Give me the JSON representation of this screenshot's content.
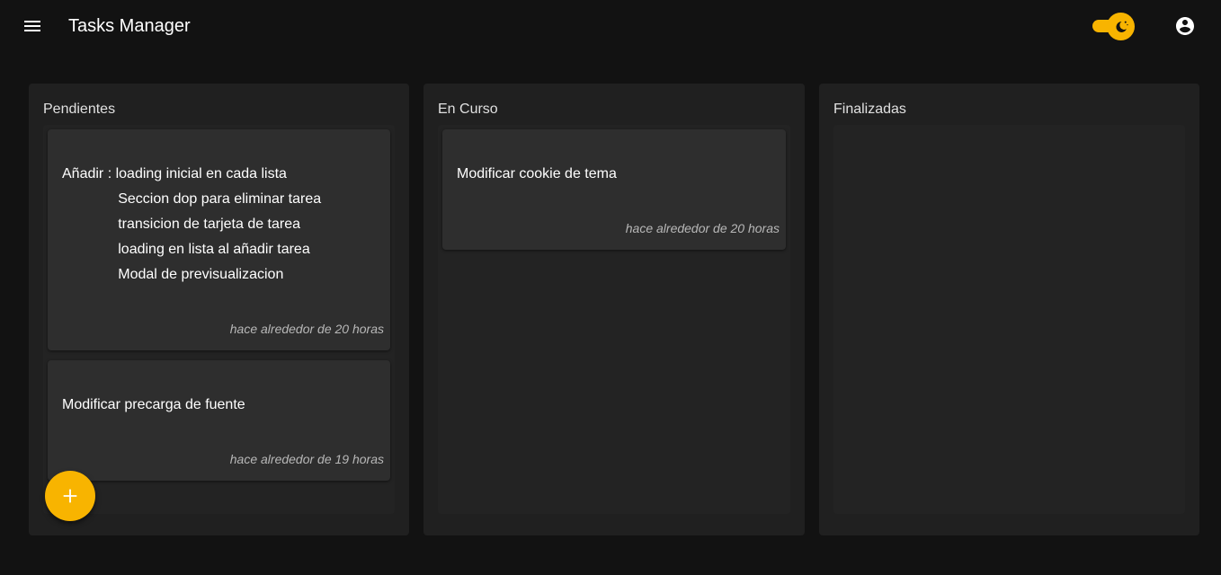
{
  "app": {
    "title": "Tasks Manager",
    "menu_icon": "menu-icon",
    "theme_icon": "moon-icon",
    "account_icon": "account-circle-icon",
    "accent_color": "#f8b400"
  },
  "columns": [
    {
      "title": "Pendientes",
      "tasks": [
        {
          "text": "Añadir : loading inicial en cada lista\n              Seccion dop para eliminar tarea\n              transicion de tarjeta de tarea\n              loading en lista al añadir tarea\n              Modal de previsualizacion",
          "time": "hace alrededor de 20 horas"
        },
        {
          "text": "Modificar precarga de fuente",
          "time": "hace alrededor de 19 horas"
        }
      ]
    },
    {
      "title": "En Curso",
      "tasks": [
        {
          "text": "Modificar cookie de tema",
          "time": "hace alrededor de 20 horas"
        }
      ]
    },
    {
      "title": "Finalizadas",
      "tasks": []
    }
  ],
  "fab": {
    "icon": "plus-icon"
  }
}
